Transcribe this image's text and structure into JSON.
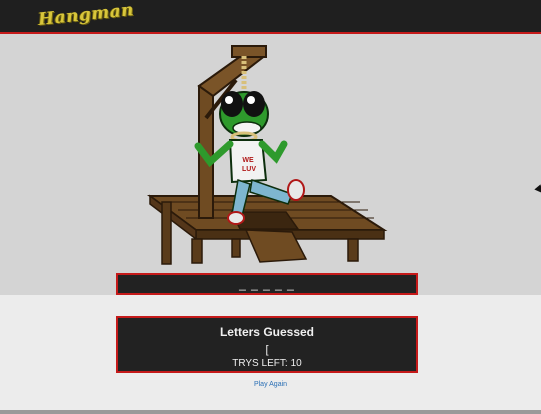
{
  "header": {
    "logo_text": "Hangman"
  },
  "game": {
    "word_mask": "_ _ _ _ _",
    "letters_guessed_title": "Letters Guessed",
    "letters_guessed": "[",
    "trys_left_label": "TRYS LEFT:",
    "trys_left": "10",
    "play_again_label": "Play Again"
  },
  "colors": {
    "accent": "#c51a1a",
    "panel": "#222222",
    "stage_bg": "#d4d4d4",
    "link": "#2a6fb5"
  }
}
